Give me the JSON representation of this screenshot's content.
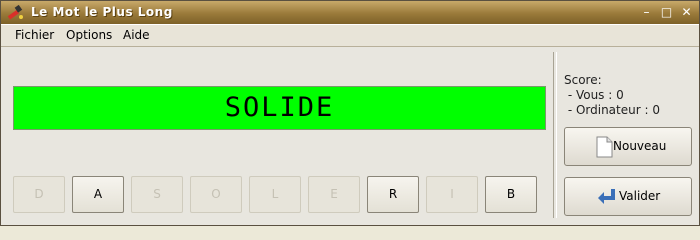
{
  "window": {
    "title": "Le Mot le Plus Long"
  },
  "menu": [
    {
      "label": "Fichier"
    },
    {
      "label": "Options"
    },
    {
      "label": "Aide"
    }
  ],
  "display": {
    "word": "SOLIDE",
    "background": "#00ff00"
  },
  "letters": [
    {
      "char": "D",
      "enabled": false
    },
    {
      "char": "A",
      "enabled": true
    },
    {
      "char": "S",
      "enabled": false
    },
    {
      "char": "O",
      "enabled": false
    },
    {
      "char": "L",
      "enabled": false
    },
    {
      "char": "E",
      "enabled": false
    },
    {
      "char": "R",
      "enabled": true
    },
    {
      "char": "I",
      "enabled": false
    },
    {
      "char": "B",
      "enabled": true
    }
  ],
  "score": {
    "heading": "Score:",
    "you": " - Vous : 0",
    "computer": " - Ordinateur : 0"
  },
  "buttons": {
    "new_label": "Nouveau",
    "validate_label": "Valider"
  }
}
